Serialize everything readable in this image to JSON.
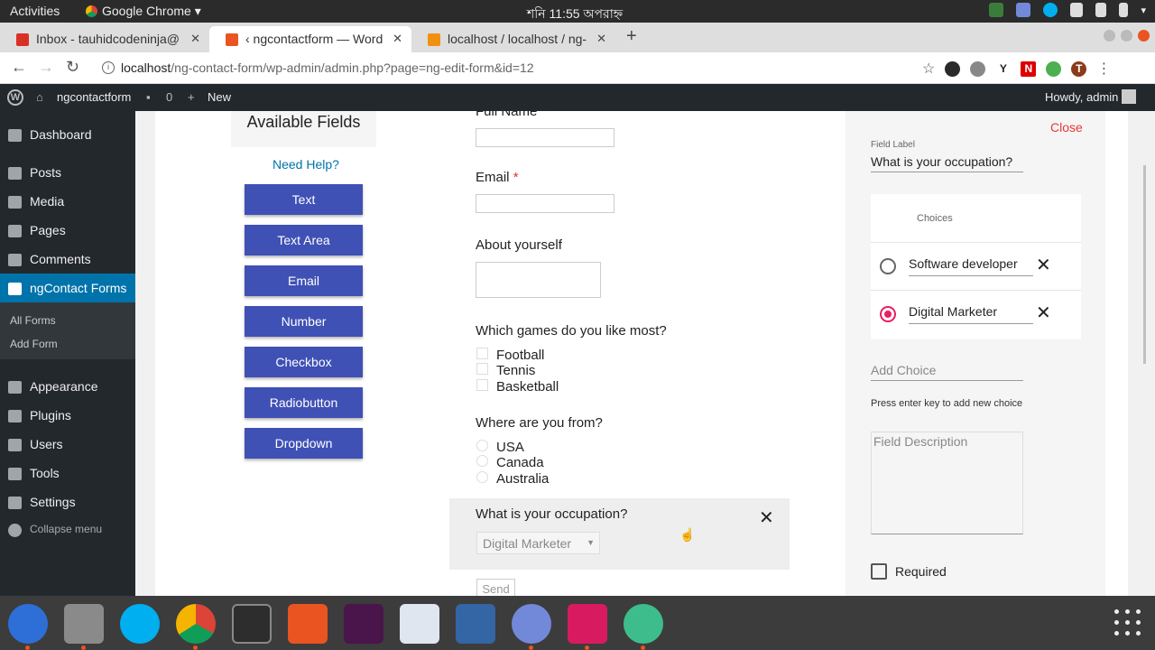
{
  "topbar": {
    "activities": "Activities",
    "app_name": "Google Chrome",
    "clock": "শনি 11:55 অপরাহ্ন"
  },
  "tabs": [
    {
      "title": "Inbox - tauhidcodeninja@",
      "favicon": "gmail-icon",
      "active": false
    },
    {
      "title": "‹ ngcontactform — Word",
      "favicon": "wordpress-icon",
      "active": true
    },
    {
      "title": "localhost / localhost / ng-",
      "favicon": "phpmyadmin-icon",
      "active": false
    }
  ],
  "omnibox": {
    "host": "localhost",
    "path": "/ng-contact-form/wp-admin/admin.php?page=ng-edit-form&id=12",
    "avatar_letter": "T"
  },
  "adminbar": {
    "site": "ngcontactform",
    "comments": "0",
    "new": "New",
    "howdy": "Howdy, admin"
  },
  "sidebar": {
    "items": [
      {
        "label": "Dashboard",
        "icon": "dashboard-icon"
      },
      {
        "label": "Posts",
        "icon": "pin-icon"
      },
      {
        "label": "Media",
        "icon": "media-icon"
      },
      {
        "label": "Pages",
        "icon": "pages-icon"
      },
      {
        "label": "Comments",
        "icon": "comment-icon"
      },
      {
        "label": "ngContact Forms",
        "icon": "form-icon"
      },
      {
        "label": "Appearance",
        "icon": "brush-icon"
      },
      {
        "label": "Plugins",
        "icon": "plugin-icon"
      },
      {
        "label": "Users",
        "icon": "user-icon"
      },
      {
        "label": "Tools",
        "icon": "wrench-icon"
      },
      {
        "label": "Settings",
        "icon": "settings-icon"
      }
    ],
    "submenu": [
      "All Forms",
      "Add Form"
    ],
    "collapse": "Collapse menu"
  },
  "available": {
    "title": "Available Fields",
    "help": "Need Help?",
    "buttons": [
      "Text",
      "Text Area",
      "Email",
      "Number",
      "Checkbox",
      "Radiobutton",
      "Dropdown"
    ]
  },
  "form": {
    "full_name": "Full Name",
    "email": "Email",
    "required_mark": "*",
    "about": "About yourself",
    "games_q": "Which games do you like most?",
    "games": [
      "Football",
      "Tennis",
      "Basketball"
    ],
    "from_q": "Where are you from?",
    "countries": [
      "USA",
      "Canada",
      "Australia"
    ],
    "occupation_q": "What is your occupation?",
    "occupation_selected": "Digital Marketer",
    "send": "Send"
  },
  "props": {
    "close": "Close",
    "field_label_caption": "Field Label",
    "field_label_value": "What is your occupation?",
    "choices_title": "Choices",
    "choices": [
      {
        "label": "Software developer",
        "selected": false
      },
      {
        "label": "Digital Marketer",
        "selected": true
      }
    ],
    "add_choice_placeholder": "Add Choice",
    "hint": "Press enter key to add new choice",
    "description_placeholder": "Field Description",
    "required_label": "Required",
    "accent": "#e91e63"
  },
  "colors": {
    "wp_dark": "#23282d",
    "wp_blue": "#0073aa",
    "button": "#3f51b5"
  }
}
